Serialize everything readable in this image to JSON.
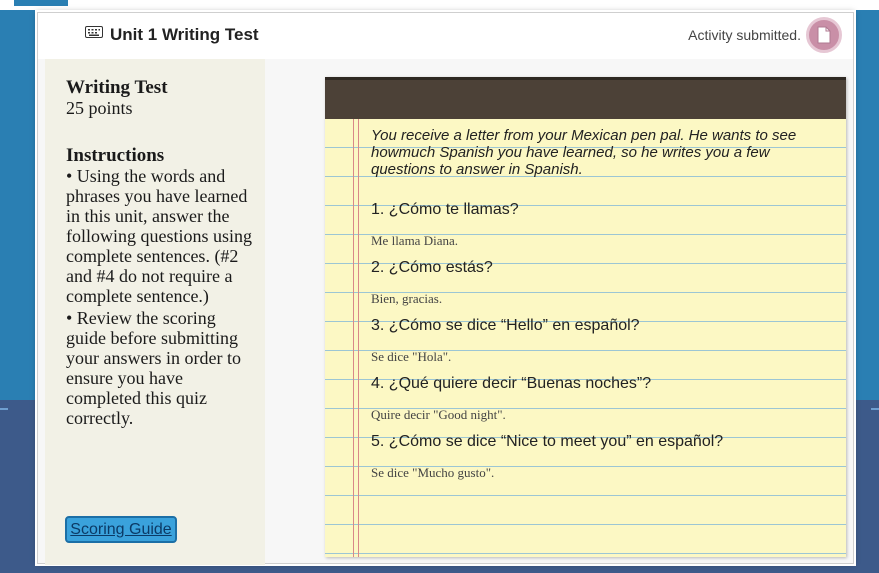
{
  "header": {
    "title": "Unit 1 Writing Test",
    "status": "Activity submitted.",
    "keyboard_icon": "keyboard-icon",
    "status_icon": "document-icon"
  },
  "sidebar": {
    "heading": "Writing Test",
    "points": "25 points",
    "instructions_heading": "Instructions",
    "bullets": [
      "• Using the words and phrases you have learned in this unit, answer the following questions using complete sentences. (#2 and #4 do not require a complete sentence.)",
      "• Review the scoring guide before submitting your answers in order to ensure you have completed this quiz correctly."
    ],
    "scoring_guide_label": "Scoring Guide"
  },
  "notebook": {
    "intro": "You receive a letter from your Mexican pen pal. He wants to see howmuch Spanish you have learned, so he writes you a few questions to answer in Spanish.",
    "questions": [
      {
        "q": "1. ¿Cómo te llamas?",
        "a": "Me llama Diana."
      },
      {
        "q": "2. ¿Cómo estás?",
        "a": "Bien, gracias."
      },
      {
        "q": "3. ¿Cómo se dice “Hello” en español?",
        "a": "Se dice \"Hola\"."
      },
      {
        "q": "4. ¿Qué quiere decir “Buenas noches”?",
        "a": "Quire decir \"Good night\"."
      },
      {
        "q": "5. ¿Cómo se dice “Nice to meet you” en español?",
        "a": "Se dice \"Mucho gusto\"."
      }
    ]
  },
  "colors": {
    "background_top": "#2a7fb3",
    "background_bottom": "#3d5a8a",
    "paper": "#fcf8c4",
    "notebook_header": "#4c4137",
    "rule_line": "#9cc6d4",
    "margin_line": "#d98888",
    "button": "#3aa2dc"
  }
}
